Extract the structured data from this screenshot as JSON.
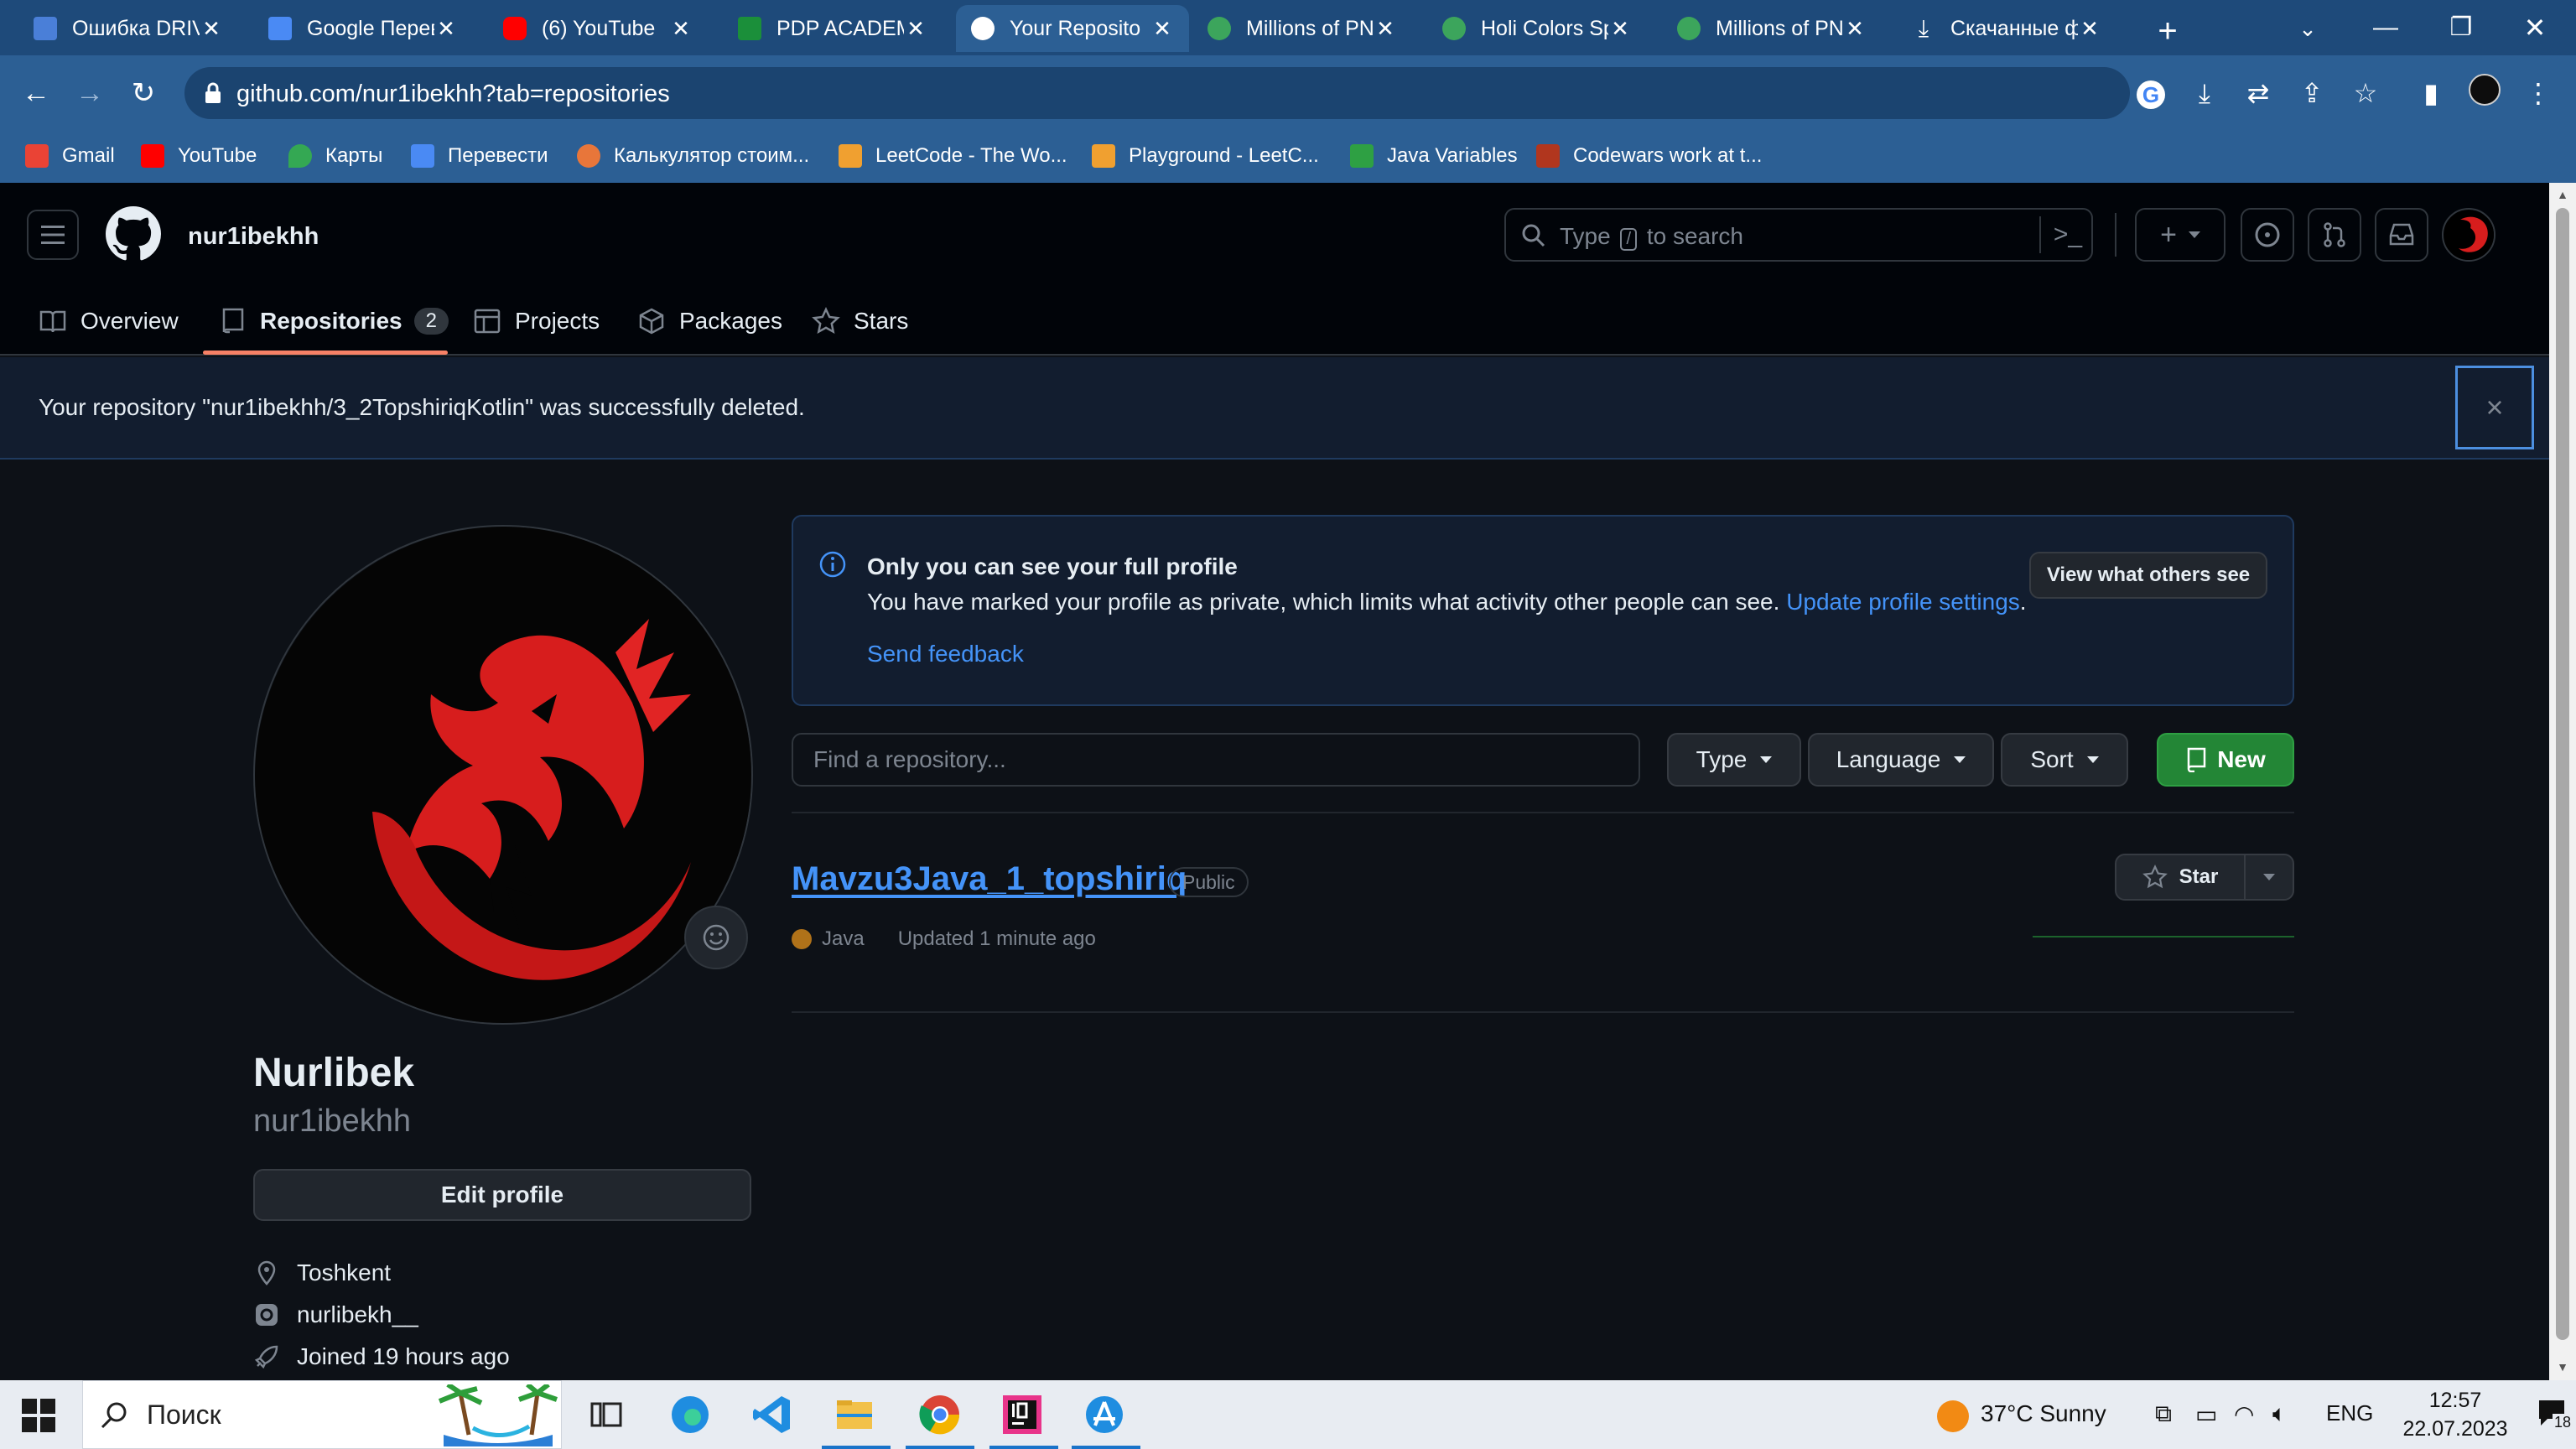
{
  "browser": {
    "tabs": [
      {
        "title": "Ошибка DRIV",
        "favicon_color": "#4a7fd8",
        "active": false
      },
      {
        "title": "Google Перев",
        "favicon_color": "#4a8af4",
        "active": false
      },
      {
        "title": "(6) YouTube",
        "favicon_color": "#ff0000",
        "active": false
      },
      {
        "title": "PDP ACADEM",
        "favicon_color": "#1b8f3a",
        "active": false
      },
      {
        "title": "Your Reposito",
        "favicon_color": "#ffffff",
        "active": true
      },
      {
        "title": "Millions of PN",
        "favicon_color": "#3ca55c",
        "active": false
      },
      {
        "title": "Holi Colors Sp",
        "favicon_color": "#3ca55c",
        "active": false
      },
      {
        "title": "Millions of PN",
        "favicon_color": "#3ca55c",
        "active": false
      },
      {
        "title": "Скачанные ф",
        "favicon_color": "#ffffff",
        "active": false
      }
    ],
    "url": "github.com/nur1ibekhh?tab=repositories",
    "bookmarks": [
      {
        "label": "Gmail",
        "color": "#ea4335"
      },
      {
        "label": "YouTube",
        "color": "#ff0000"
      },
      {
        "label": "Карты",
        "color": "#34a853"
      },
      {
        "label": "Перевести",
        "color": "#4a8af4"
      },
      {
        "label": "Калькулятор стоим...",
        "color": "#e8763a"
      },
      {
        "label": "LeetCode - The Wo...",
        "color": "#f0a030"
      },
      {
        "label": "Playground - LeetC...",
        "color": "#f0a030"
      },
      {
        "label": "Java Variables",
        "color": "#2ea043"
      },
      {
        "label": "Codewars work at t...",
        "color": "#b1361e"
      }
    ]
  },
  "github": {
    "header": {
      "username": "nur1ibekhh",
      "search_placeholder_pre": "Type",
      "search_key": "/",
      "search_placeholder_post": "to search"
    },
    "nav": [
      {
        "label": "Overview",
        "icon": "book-icon"
      },
      {
        "label": "Repositories",
        "icon": "repo-icon",
        "count": "2"
      },
      {
        "label": "Projects",
        "icon": "table-icon"
      },
      {
        "label": "Packages",
        "icon": "package-icon"
      },
      {
        "label": "Stars",
        "icon": "star-icon"
      }
    ],
    "flash": {
      "message": "Your repository \"nur1ibekhh/3_2TopshiriqKotlin\" was successfully deleted.",
      "close": "×"
    },
    "profile": {
      "name": "Nurlibek",
      "login": "nur1ibekhh",
      "edit_label": "Edit profile",
      "location": "Toshkent",
      "social": "nurlibekh__",
      "joined": "Joined 19 hours ago"
    },
    "notice": {
      "title": "Only you can see your full profile",
      "text": "You have marked your profile as private, which limits what activity other people can see.",
      "link": "Update profile settings",
      "period": ".",
      "feedback": "Send feedback",
      "view_button": "View what others see"
    },
    "filters": {
      "find_placeholder": "Find a repository...",
      "type": "Type",
      "language": "Language",
      "sort": "Sort",
      "new": "New"
    },
    "repos": [
      {
        "name": "Mavzu3Java_1_topshiriq",
        "visibility": "Public",
        "language": "Java",
        "language_color": "#b07219",
        "updated": "Updated 1 minute ago",
        "star_label": "Star"
      }
    ]
  },
  "taskbar": {
    "search": "Поиск",
    "weather": "37°C  Sunny",
    "lang": "ENG",
    "time": "12:57",
    "date": "22.07.2023",
    "notifications": "18"
  }
}
